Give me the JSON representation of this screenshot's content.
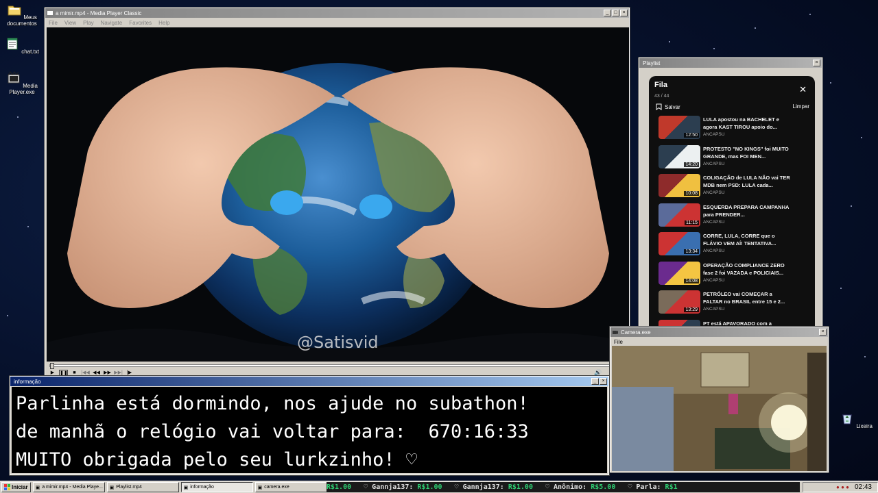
{
  "desktop": {
    "icons": [
      {
        "label": "Meus documentos",
        "icon": "folder-icon"
      },
      {
        "label": "chat.txt",
        "icon": "notepad-icon"
      },
      {
        "label": "Media Player.exe",
        "icon": "media-player-icon"
      }
    ],
    "recycle_bin_label": "Lixeira"
  },
  "media_player": {
    "title": "a mimir.mp4 - Media Player Classic",
    "menu": [
      "File",
      "View",
      "Play",
      "Navigate",
      "Favorites",
      "Help"
    ],
    "watermark": "@Satisvid",
    "progress": 0.0
  },
  "playlist_window": {
    "title": "Playlist",
    "heading": "Fila",
    "count": "43 / 44",
    "save_label": "Salvar",
    "clear_label": "Limpar",
    "items": [
      {
        "title": "LULA apostou na BACHELET e agora KAST TIROU apoio do...",
        "duration": "12:50",
        "channel": "ANCAPSU"
      },
      {
        "title": "PROTESTO \"NO KINGS\" foi MUITO GRANDE, mas FOI MEN...",
        "duration": "14:20",
        "channel": "ANCAPSU"
      },
      {
        "title": "COLIGAÇÃO de LULA NÃO vai TER MDB nem PSD: LULA cada...",
        "duration": "10:08",
        "channel": "ANCAPSU"
      },
      {
        "title": "ESQUERDA PREPARA CAMPANHA para PRENDER...",
        "duration": "11:15",
        "channel": "ANCAPSU"
      },
      {
        "title": "CORRE, LULA, CORRE que o FLÁVIO VEM AÍ! TENTATIVA...",
        "duration": "13:34",
        "channel": "ANCAPSU"
      },
      {
        "title": "OPERAÇÃO COMPLIANCE ZERO fase 2 foi VAZADA e POLICIAIS...",
        "duration": "14:08",
        "channel": "ANCAPSU"
      },
      {
        "title": "PETRÓLEO vai COMEÇAR a FALTAR no BRASIL entre 15 e 2...",
        "duration": "13:29",
        "channel": "ANCAPSU"
      },
      {
        "title": "PT está APAVORADO com a",
        "duration": "",
        "channel": ""
      }
    ]
  },
  "info_window": {
    "title": "informação",
    "line1": "Parlinha está dormindo, nos ajude no subathon!",
    "line2": "de manhã o relógio vai voltar para:  670:16:33",
    "line3": "MUITO obrigada pelo seu lurkzinho! ♡"
  },
  "camera_window": {
    "title": "Camera.exe",
    "menu": [
      "File"
    ]
  },
  "taskbar": {
    "start_label": "Iniciar",
    "tasks": [
      {
        "label": "a mimir.mp4 - Media Playe...",
        "pressed": false
      },
      {
        "label": "Playlist.mp4",
        "pressed": false
      },
      {
        "label": "informação",
        "pressed": true
      },
      {
        "label": "camera.exe",
        "pressed": false
      }
    ],
    "ticker": [
      {
        "name": "",
        "amount": "R$1.00"
      },
      {
        "name": "Gannja137:",
        "amount": "R$1.00"
      },
      {
        "name": "Gannja137:",
        "amount": "R$1.00"
      },
      {
        "name": "Anônimo:",
        "amount": "R$5.00"
      },
      {
        "name": "Parla:",
        "amount": "R$1"
      }
    ],
    "clock": "02:43"
  }
}
